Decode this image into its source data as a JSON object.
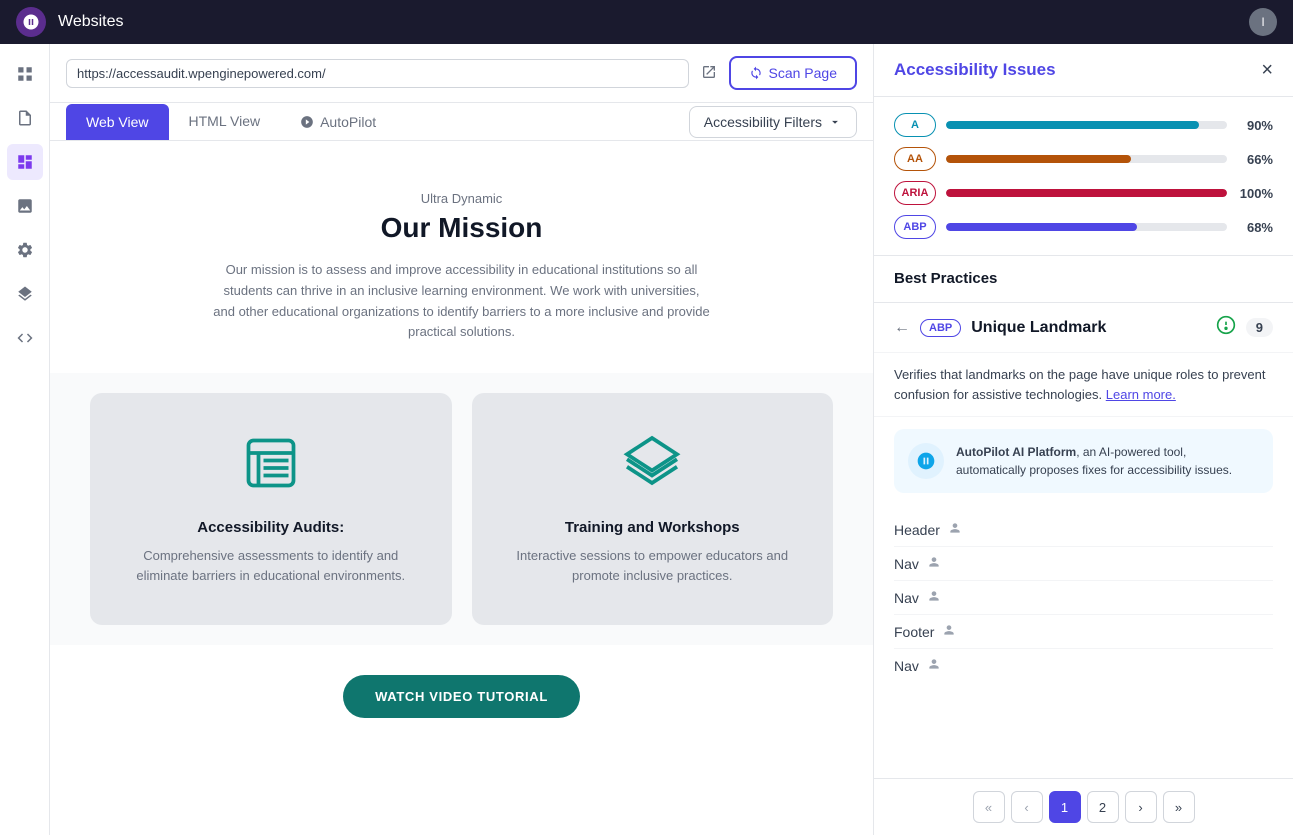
{
  "topbar": {
    "title": "Websites",
    "avatar_label": "I"
  },
  "url_bar": {
    "url": "https://accessaudit.wpenginepowered.com/",
    "scan_button": "Scan Page"
  },
  "view_tabs": {
    "tabs": [
      {
        "id": "web",
        "label": "Web View",
        "active": true
      },
      {
        "id": "html",
        "label": "HTML View",
        "active": false
      },
      {
        "id": "autopilot",
        "label": "AutoPilot",
        "active": false
      }
    ],
    "filter_button": "Accessibility Filters"
  },
  "web_content": {
    "hero_subtitle": "Ultra Dynamic",
    "hero_title": "Our Mission",
    "hero_text": "Our mission is to assess and improve accessibility in educational institutions so all students can thrive in an inclusive learning environment. We work with universities, and other educational organizations to identify barriers to a more inclusive and provide practical solutions.",
    "cards": [
      {
        "title": "Accessibility Audits:",
        "text": "Comprehensive assessments to identify and eliminate barriers in educational environments.",
        "icon": "book"
      },
      {
        "title": "Training and Workshops",
        "text": "Interactive sessions to empower educators and promote inclusive practices.",
        "icon": "layers"
      }
    ],
    "watch_button": "WATCH VIDEO TUTORIAL"
  },
  "right_panel": {
    "title": "Accessibility Issues",
    "close_label": "×",
    "scores": [
      {
        "badge": "A",
        "pct": 90,
        "pct_label": "90%",
        "type": "a"
      },
      {
        "badge": "AA",
        "pct": 66,
        "pct_label": "66%",
        "type": "aa"
      },
      {
        "badge": "ARIA",
        "pct": 100,
        "pct_label": "100%",
        "type": "aria"
      },
      {
        "badge": "ABP",
        "pct": 68,
        "pct_label": "68%",
        "type": "abp"
      }
    ],
    "detail": {
      "section_title": "Best Practices",
      "landmark_badge": "ABP",
      "landmark_title": "Unique Landmark",
      "count": "9",
      "description": "Verifies that landmarks on the page have unique roles to prevent confusion for assistive technologies.",
      "learn_more": "Learn more.",
      "autopilot_label": "AutoPilot AI Platform",
      "autopilot_text": ", an AI-powered tool, automatically proposes fixes for accessibility issues.",
      "landmarks": [
        {
          "name": "Header"
        },
        {
          "name": "Nav"
        },
        {
          "name": "Nav"
        },
        {
          "name": "Footer"
        },
        {
          "name": "Nav"
        }
      ],
      "pagination": {
        "first_label": "«",
        "prev_label": "‹",
        "current": 1,
        "next_page": 2,
        "next_label": "›",
        "last_label": "»"
      }
    }
  },
  "sidebar": {
    "icons": [
      {
        "name": "grid-icon",
        "symbol": "⊞"
      },
      {
        "name": "document-icon",
        "symbol": "📄"
      },
      {
        "name": "layout-icon",
        "symbol": "▤"
      },
      {
        "name": "image-icon",
        "symbol": "🖼"
      },
      {
        "name": "settings-icon",
        "symbol": "⚙"
      },
      {
        "name": "layers-icon",
        "symbol": "◧"
      },
      {
        "name": "code-icon",
        "symbol": "⌨"
      }
    ]
  }
}
